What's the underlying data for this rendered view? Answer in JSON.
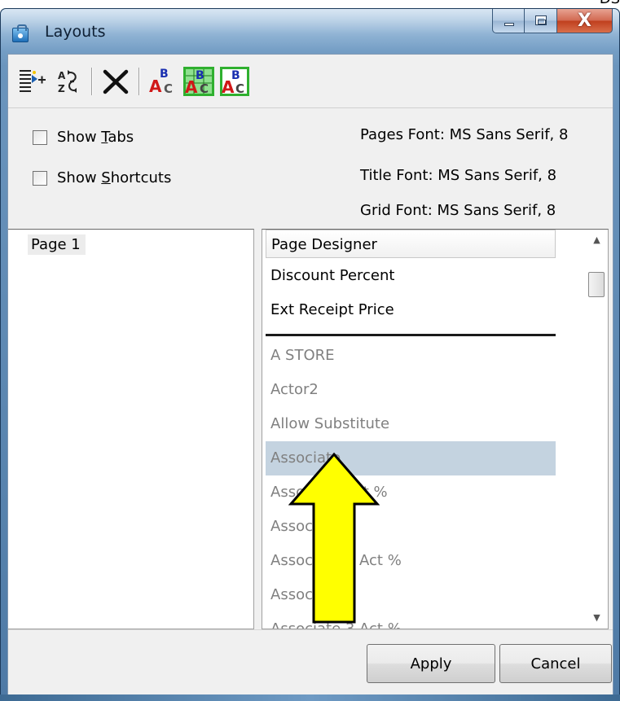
{
  "background_text": "DS",
  "window": {
    "title": "Layouts",
    "minimize_label": "_",
    "close_label": "X"
  },
  "toolbar": {
    "icons": [
      "add-field-icon",
      "sort-icon",
      "delete-icon",
      "font-pages-icon",
      "font-title-icon",
      "font-grid-icon"
    ]
  },
  "options": {
    "show_tabs": {
      "pre": "Show ",
      "key": "T",
      "post": "abs",
      "checked": false
    },
    "show_shortcuts": {
      "pre": "Show ",
      "key": "S",
      "post": "hortcuts",
      "checked": false
    },
    "pages_font": "Pages Font: MS Sans Serif, 8",
    "title_font": "Title Font: MS Sans Serif, 8",
    "grid_font": "Grid Font: MS Sans Serif, 8"
  },
  "pages": [
    "Page 1"
  ],
  "designer": {
    "header": "Page Designer",
    "used_fields": [
      "Discount Percent",
      "Ext Receipt Price"
    ],
    "available_fields": [
      "A STORE",
      "Actor2",
      "Allow Substitute",
      "Associate",
      "Associate Act %",
      "Associate 2",
      "Associate 2 Act %",
      "Associate 3",
      "Associate 3 Act %"
    ],
    "selected": "Associate"
  },
  "buttons": {
    "apply": "Apply",
    "cancel": "Cancel"
  },
  "colors": {
    "selection": "#c4d3e0",
    "arrow_fill": "#ffff00",
    "frame": "#6b95bd"
  }
}
